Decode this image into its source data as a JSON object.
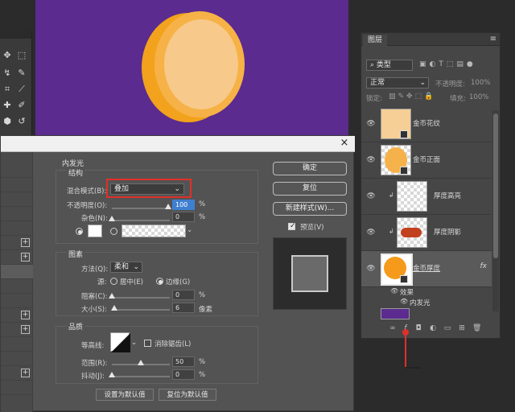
{
  "colors": {
    "canvas_bg": "#5b2b8f",
    "coin_face": "#f7c98a",
    "coin_edge": "#f2a21c",
    "coin_front": "#f6a83a",
    "dialog_bg": "#535353",
    "layers_bg": "#464646",
    "highlight_red": "#e0302a",
    "accent_blue": "#3f7fd0"
  },
  "dialog": {
    "section_title": "内发光",
    "structure": {
      "title": "结构",
      "blend_mode_label": "混合模式(B):",
      "blend_mode_value": "叠加",
      "opacity_label": "不透明度(O):",
      "opacity_value": "100",
      "opacity_unit": "%",
      "opacity_fraction": 1.0,
      "noise_label": "杂色(N):",
      "noise_value": "0",
      "noise_unit": "%",
      "noise_fraction": 0.0
    },
    "elements": {
      "title": "图素",
      "method_label": "方法(Q):",
      "method_value": "柔和",
      "source_label": "源:",
      "source_center": "居中(E)",
      "source_edge": "边缘(G)",
      "choke_label": "阻塞(C):",
      "choke_value": "0",
      "choke_unit": "%",
      "choke_fraction": 0.0,
      "size_label": "大小(S):",
      "size_value": "6",
      "size_unit": "像素",
      "size_fraction": 0.03
    },
    "quality": {
      "title": "品质",
      "contour_label": "等高线:",
      "antialias_label": "消除锯齿(L)",
      "range_label": "范围(R):",
      "range_value": "50",
      "range_unit": "%",
      "range_fraction": 0.5,
      "jitter_label": "抖动(J):",
      "jitter_value": "0",
      "jitter_unit": "%",
      "jitter_fraction": 0.0
    },
    "make_default": "设置为默认值",
    "reset_default": "复位为默认值",
    "buttons": {
      "ok": "确定",
      "reset": "复位",
      "new_style": "新建样式(W)...",
      "preview": "预览(V)"
    },
    "close_glyph": "×"
  },
  "layers": {
    "tab": "图层",
    "filter_kind": "类型",
    "blend_mode": "正常",
    "opacity_label": "不透明度:",
    "opacity_value": "100%",
    "lock_label": "锁定:",
    "fill_label": "填充:",
    "fill_value": "100%",
    "items": [
      {
        "name": "金币花纹"
      },
      {
        "name": "金币正面"
      },
      {
        "name": "厚度高亮"
      },
      {
        "name": "厚度阴影"
      },
      {
        "name": "金币厚度",
        "fx": "fx"
      }
    ],
    "effects_label": "效果",
    "inner_glow_label": "内发光"
  }
}
